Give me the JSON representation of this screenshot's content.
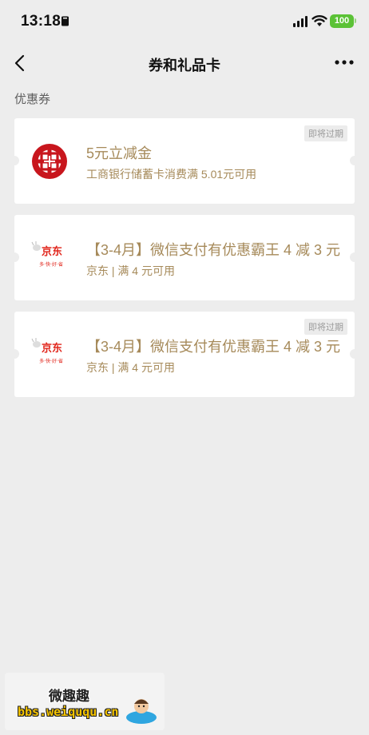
{
  "status_bar": {
    "time": "13:18",
    "battery": "100",
    "icons": [
      "book-icon",
      "signal-icon",
      "wifi-icon",
      "battery-icon"
    ]
  },
  "nav": {
    "title": "券和礼品卡",
    "back_icon": "chevron-left-icon",
    "more_icon": "more-dots-icon"
  },
  "section": {
    "title": "优惠券"
  },
  "coupons": [
    {
      "title": "5元立减金",
      "subtitle": "工商银行储蓄卡消费满 5.01元可用",
      "badge": "即将过期",
      "logo": "icbc-logo"
    },
    {
      "title": "【3-4月】微信支付有优惠霸王 4 减 3 元",
      "subtitle": "京东 | 满 4 元可用",
      "badge": "",
      "logo": "jd-logo"
    },
    {
      "title": "【3-4月】微信支付有优惠霸王 4 减 3 元",
      "subtitle": "京东 | 满 4 元可用",
      "badge": "即将过期",
      "logo": "jd-logo"
    }
  ],
  "jd_logo": {
    "brand": "京东",
    "slogan": "多·快·好·省"
  },
  "watermark": {
    "cn": "微趣趣",
    "url": "bbs.weiququ.cn"
  },
  "colors": {
    "background": "#ededed",
    "coupon_text": "#a68a5a",
    "icbc_red": "#c8161d",
    "jd_red": "#e1251b",
    "battery": "#5bc236"
  }
}
